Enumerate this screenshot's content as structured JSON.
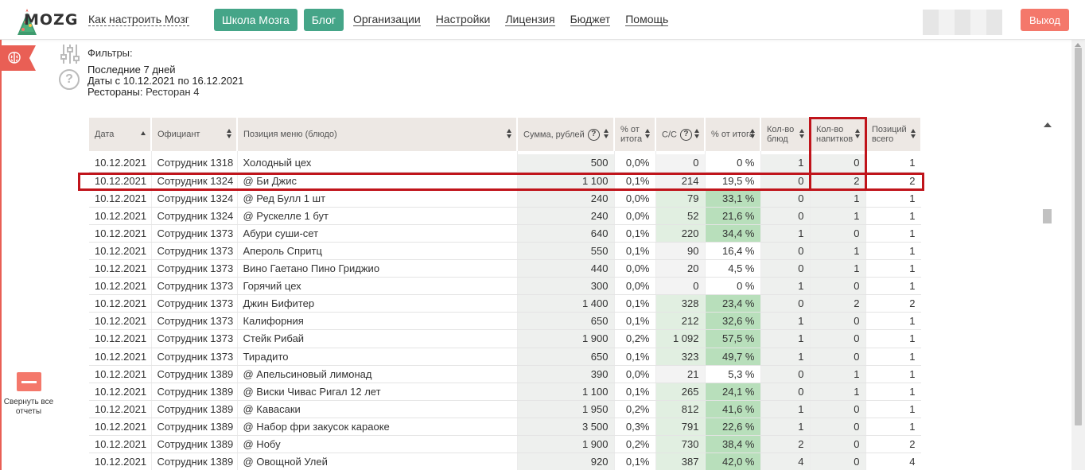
{
  "header": {
    "logo_text": "MOZG",
    "nav_links": [
      "Как настроить Мозг"
    ],
    "buttons": [
      "Школа Мозга",
      "Блог"
    ],
    "menu": [
      "Организации",
      "Настройки",
      "Лицензия",
      "Бюджет",
      "Помощь"
    ],
    "logout": "Выход"
  },
  "sidebar": {
    "collapse_label": "Свернуть все отчеты"
  },
  "filters": {
    "title": "Фильтры:",
    "period": "Последние 7 дней",
    "dates": "Даты с 10.12.2021 по 16.12.2021",
    "restaurants_label": "Рестораны:",
    "restaurants_value": "Ресторан 4"
  },
  "table": {
    "columns": [
      {
        "label": "Дата",
        "sort": "up",
        "help": false
      },
      {
        "label": "Официант",
        "sort": "both",
        "help": false
      },
      {
        "label": "Позиция меню (блюдо)",
        "sort": "both",
        "help": false
      },
      {
        "label": "Сумма, рублей",
        "sort": "both",
        "help": true
      },
      {
        "label": "% от итога",
        "sort": "both",
        "help": false
      },
      {
        "label": "С/С",
        "sort": "both",
        "help": true
      },
      {
        "label": "% от итога",
        "sort": "both",
        "help": false
      },
      {
        "label": "Кол-во блюд",
        "sort": "both",
        "help": false
      },
      {
        "label": "Кол-во напитков",
        "sort": "both",
        "help": false
      },
      {
        "label": "Позиций всего",
        "sort": "both",
        "help": false
      }
    ],
    "rows": [
      [
        "10.12.2021",
        "Сотрудник 1318",
        "Холодный цех",
        "500",
        "0,0%",
        "0",
        "0 %",
        "1",
        "0",
        "1"
      ],
      [
        "10.12.2021",
        "Сотрудник 1324",
        "@ Би Джис",
        "1 100",
        "0,1%",
        "214",
        "19,5 %",
        "0",
        "2",
        "2"
      ],
      [
        "10.12.2021",
        "Сотрудник 1324",
        "@ Ред Булл 1 шт",
        "240",
        "0,0%",
        "79",
        "33,1 %",
        "0",
        "1",
        "1"
      ],
      [
        "10.12.2021",
        "Сотрудник 1324",
        "@ Рускелле 1 бут",
        "240",
        "0,0%",
        "52",
        "21,6 %",
        "0",
        "1",
        "1"
      ],
      [
        "10.12.2021",
        "Сотрудник 1373",
        "Абури суши-сет",
        "640",
        "0,1%",
        "220",
        "34,4 %",
        "1",
        "0",
        "1"
      ],
      [
        "10.12.2021",
        "Сотрудник 1373",
        "Апероль Спритц",
        "550",
        "0,1%",
        "90",
        "16,4 %",
        "0",
        "1",
        "1"
      ],
      [
        "10.12.2021",
        "Сотрудник 1373",
        "Вино Гаетано Пино Гриджио",
        "440",
        "0,0%",
        "20",
        "4,5 %",
        "0",
        "1",
        "1"
      ],
      [
        "10.12.2021",
        "Сотрудник 1373",
        "Горячий цех",
        "300",
        "0,0%",
        "0",
        "0 %",
        "1",
        "0",
        "1"
      ],
      [
        "10.12.2021",
        "Сотрудник 1373",
        "Джин Бифитер",
        "1 400",
        "0,1%",
        "328",
        "23,4 %",
        "0",
        "2",
        "2"
      ],
      [
        "10.12.2021",
        "Сотрудник 1373",
        "Калифорния",
        "650",
        "0,1%",
        "212",
        "32,6 %",
        "1",
        "0",
        "1"
      ],
      [
        "10.12.2021",
        "Сотрудник 1373",
        "Стейк Рибай",
        "1 900",
        "0,2%",
        "1 092",
        "57,5 %",
        "1",
        "0",
        "1"
      ],
      [
        "10.12.2021",
        "Сотрудник 1373",
        "Тирадито",
        "650",
        "0,1%",
        "323",
        "49,7 %",
        "1",
        "0",
        "1"
      ],
      [
        "10.12.2021",
        "Сотрудник 1389",
        "@ Апельсиновый лимонад",
        "390",
        "0,0%",
        "21",
        "5,3 %",
        "0",
        "1",
        "1"
      ],
      [
        "10.12.2021",
        "Сотрудник 1389",
        "@ Виски Чивас Ригал 12 лет",
        "1 100",
        "0,1%",
        "265",
        "24,1 %",
        "0",
        "1",
        "1"
      ],
      [
        "10.12.2021",
        "Сотрудник 1389",
        "@ Кавасаки",
        "1 950",
        "0,2%",
        "812",
        "41,6 %",
        "1",
        "0",
        "1"
      ],
      [
        "10.12.2021",
        "Сотрудник 1389",
        "@ Набор фри закусок караоке",
        "3 500",
        "0,3%",
        "791",
        "22,6 %",
        "1",
        "0",
        "1"
      ],
      [
        "10.12.2021",
        "Сотрудник 1389",
        "@ Нобу",
        "1 900",
        "0,2%",
        "730",
        "38,4 %",
        "2",
        "0",
        "2"
      ],
      [
        "10.12.2021",
        "Сотрудник 1389",
        "@ Овощной Улей",
        "920",
        "0,1%",
        "387",
        "42,0 %",
        "4",
        "0",
        "4"
      ]
    ],
    "highlighted_row_index": 1
  }
}
